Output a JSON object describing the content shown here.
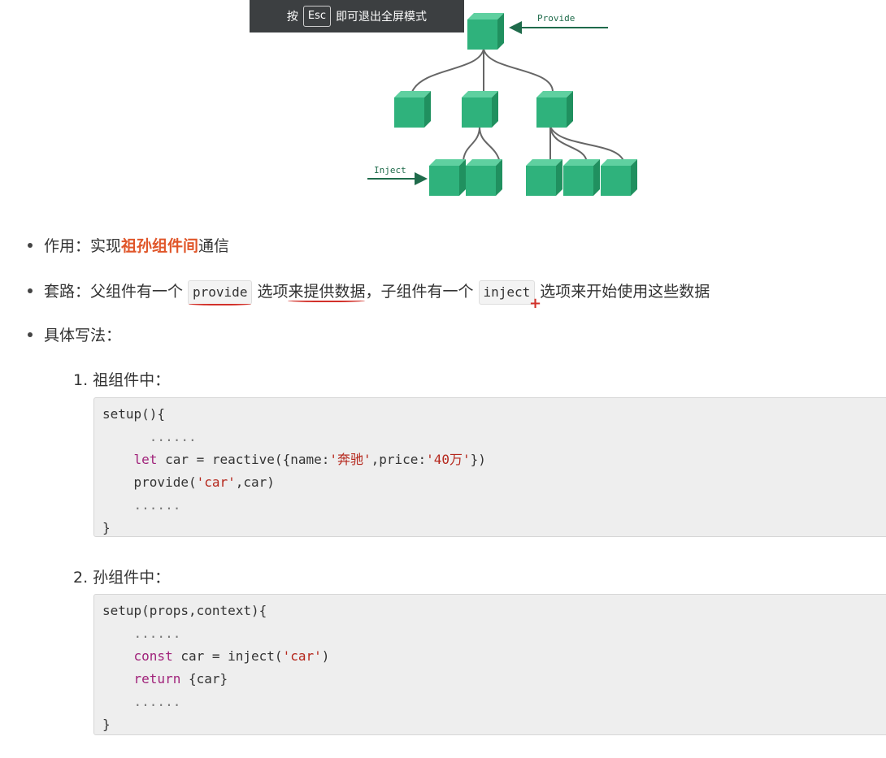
{
  "banner": {
    "pre": "按",
    "key": "Esc",
    "post": "即可退出全屏模式"
  },
  "diagram": {
    "provide_label": "Provide",
    "inject_label": "Inject",
    "cube_color": "#2fb27c"
  },
  "bullets": {
    "b1": {
      "prefix": "作用：实现",
      "highlight": "祖孙组件间",
      "suffix": "通信"
    },
    "b2": {
      "prefix": "套路：父组件有一个",
      "chip1": "provide",
      "mid1": "选项",
      "underlined": "来提供数据",
      "mid2": "，子组件有一个",
      "chip2": "inject",
      "suffix": "选项来开始使用这些数据"
    },
    "b3": {
      "text": "具体写法："
    }
  },
  "steps": {
    "s1": {
      "title": "1. 祖组件中：",
      "l1": "setup(){",
      "l2_dots": "......",
      "l3_kw": "let",
      "l3_a": " car = reactive({name:",
      "l3_s1": "'奔驰'",
      "l3_b": ",price:",
      "l3_s2": "'40万'",
      "l3_c": "})",
      "l4_a": "provide(",
      "l4_s": "'car'",
      "l4_b": ",car)",
      "l5_dots": "......",
      "l6": "}"
    },
    "s2": {
      "title": "2. 孙组件中：",
      "l1": "setup(props,context){",
      "l2_dots": "......",
      "l3_kw": "const",
      "l3_a": " car = inject(",
      "l3_s": "'car'",
      "l3_b": ")",
      "l4_kw": "return",
      "l4_a": " {car}",
      "l5_dots": "......",
      "l6": "}"
    }
  }
}
